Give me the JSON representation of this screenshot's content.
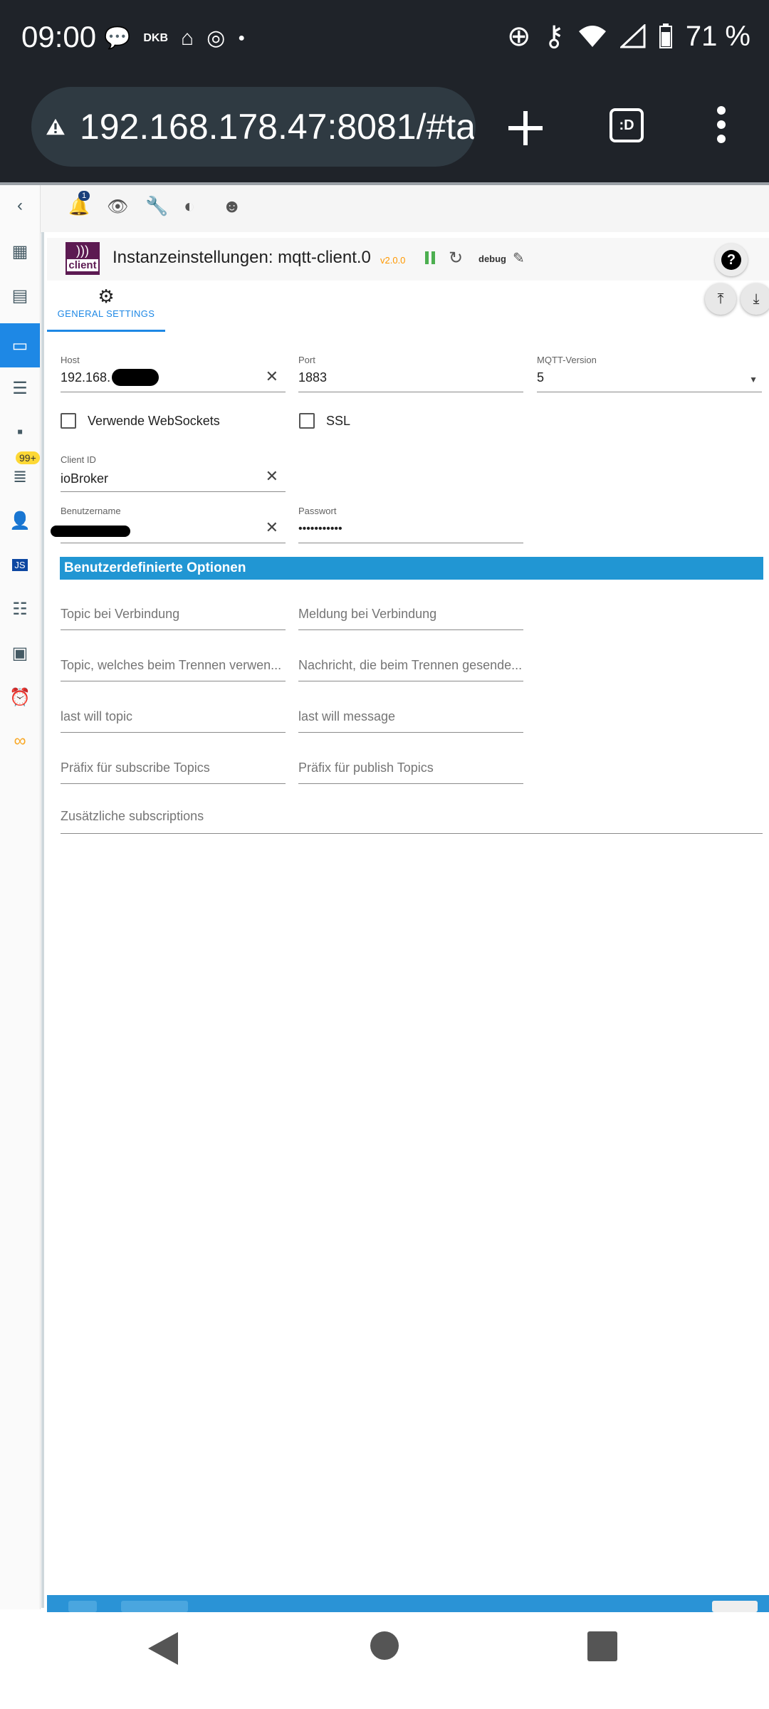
{
  "status_bar": {
    "time": "09:00",
    "carrier_label": "DKB",
    "battery": "71 %"
  },
  "browser": {
    "url": "192.168.178.47:8081/#ta",
    "tab_switcher_label": ":D"
  },
  "app_toolbar": {
    "notification_count": "1"
  },
  "sidebar": {
    "log_badge": "99+"
  },
  "instance": {
    "title": "Instanzeinstellungen: mqtt-client.0",
    "version": "v2.0.0",
    "log_level": "debug",
    "logo_text": "client"
  },
  "tabs": [
    {
      "label": "GENERAL SETTINGS"
    }
  ],
  "form": {
    "host": {
      "label": "Host",
      "value": "192.168."
    },
    "port": {
      "label": "Port",
      "value": "1883"
    },
    "mqtt_version": {
      "label": "MQTT-Version",
      "value": "5"
    },
    "websockets": {
      "label": "Verwende WebSockets"
    },
    "ssl": {
      "label": "SSL"
    },
    "client_id": {
      "label": "Client ID",
      "value": "ioBroker"
    },
    "username": {
      "label": "Benutzername",
      "value": ""
    },
    "password": {
      "label": "Passwort",
      "value": "•••••••••••"
    },
    "section_title": "Benutzerdefinierte Optionen",
    "placeholders": {
      "topic_connect": "Topic bei Verbindung",
      "message_connect": "Meldung bei Verbindung",
      "topic_disconnect": "Topic, welches beim Trennen verwen...",
      "message_disconnect": "Nachricht, die beim Trennen gesende...",
      "lastwill_topic": "last will topic",
      "lastwill_message": "last will message",
      "prefix_subscribe": "Präfix für subscribe Topics",
      "prefix_publish": "Präfix für publish Topics",
      "additional_subscriptions": "Zusätzliche subscriptions"
    }
  },
  "colors": {
    "accent": "#1e88e5",
    "section": "#2196d3",
    "version": "#ff9800",
    "running": "#4caf50",
    "logo": "#5c1a52"
  }
}
